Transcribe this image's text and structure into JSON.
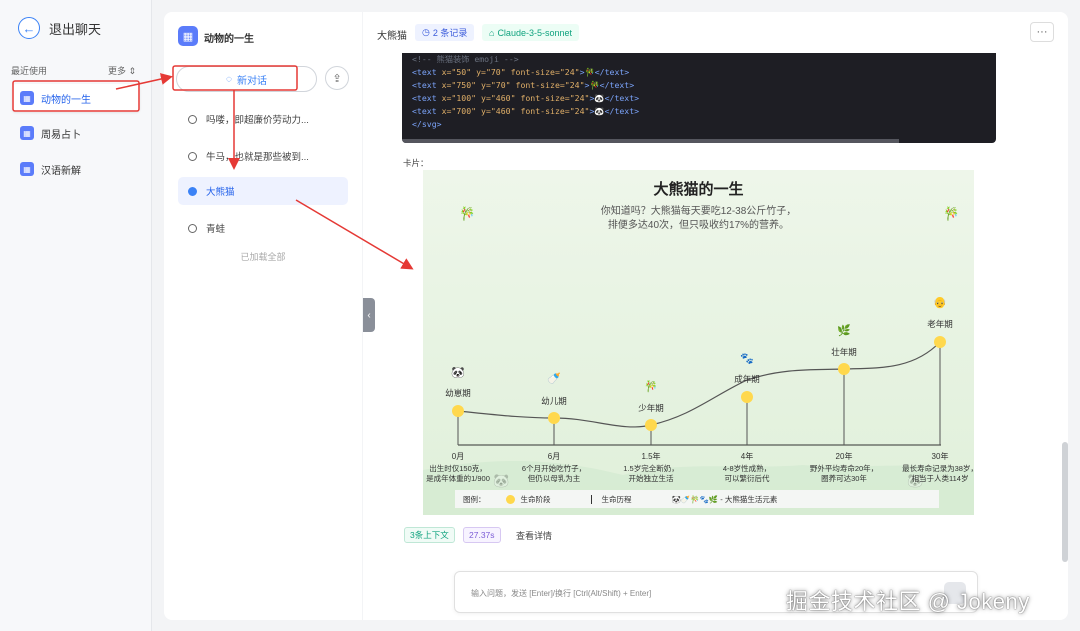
{
  "sidebar": {
    "exit_label": "退出聊天",
    "recent_label": "最近使用",
    "more_label": "更多 ⇕",
    "apps": [
      {
        "label": "动物的一生"
      },
      {
        "label": "周易占卜"
      },
      {
        "label": "汉语新解"
      }
    ]
  },
  "conversations": {
    "app_title": "动物的一生",
    "new_chat_label": "新对话",
    "items": [
      {
        "label": "吗喽，即超廉价劳动力..."
      },
      {
        "label": "牛马，也就是那些被到..."
      },
      {
        "label": "大熊猫"
      },
      {
        "label": "青蛙"
      }
    ],
    "loaded_all": "已加载全部"
  },
  "chat": {
    "name": "大熊猫",
    "records_tag": "2 条记录",
    "model_tag": "Claude-3-5-sonnet",
    "code_lines": [
      {
        "text": "<!-- 熊猫装饰 emoji -->",
        "kind": "comment"
      },
      {
        "pre": "<text ",
        "attr": "x=\"50\" y=\"70\" font-size=\"24\"",
        "post": ">🎋</text>"
      },
      {
        "pre": "<text ",
        "attr": "x=\"750\" y=\"70\" font-size=\"24\"",
        "post": ">🎋</text>"
      },
      {
        "pre": "<text ",
        "attr": "x=\"100\" y=\"460\" font-size=\"24\"",
        "post": ">🐼</text>"
      },
      {
        "pre": "<text ",
        "attr": "x=\"700\" y=\"460\" font-size=\"24\"",
        "post": ">🐼</text>"
      },
      {
        "text": "</svg>",
        "kind": "tag"
      }
    ],
    "card_label": "卡片：",
    "context_chip": "3条上下文",
    "time_chip": "27.37s",
    "detail_label": "查看详情",
    "input_placeholder": "输入问题，发送 [Enter]/换行 [Ctrl(Alt/Shift) + Enter]"
  },
  "card": {
    "title": "大熊猫的一生",
    "subtitle_1": "你知道吗？大熊猫每天要吃12-38公斤竹子，",
    "subtitle_2": "排便多达40次，但只吸收约17%的营养。",
    "stages": [
      {
        "x_label": "0月",
        "stage": "幼崽期",
        "emoji": "🐼",
        "desc": [
          "出生时仅150克，",
          "是成年体重的1/900"
        ]
      },
      {
        "x_label": "6月",
        "stage": "幼儿期",
        "emoji": "🍼",
        "desc": [
          "6个月开始吃竹子，",
          "但仍以母乳为主"
        ]
      },
      {
        "x_label": "1.5年",
        "stage": "少年期",
        "emoji": "🎋",
        "desc": [
          "1.5岁完全断奶，",
          "开始独立生活"
        ]
      },
      {
        "x_label": "4年",
        "stage": "成年期",
        "emoji": "🐾",
        "desc": [
          "4-8岁性成熟，",
          "可以繁衍后代"
        ]
      },
      {
        "x_label": "20年",
        "stage": "壮年期",
        "emoji": "🌿",
        "desc": [
          "野外平均寿命20年，",
          "圈养可达30年"
        ]
      },
      {
        "x_label": "30年",
        "stage": "老年期",
        "emoji": "👴",
        "desc": [
          "最长寿命记录为38岁，",
          "相当于人类114岁"
        ]
      }
    ],
    "deco_emoji": [
      "🎋",
      "🎋",
      "🐼",
      "🐼"
    ],
    "legend_label": "图例：",
    "legend_stage": "生命阶段",
    "legend_line": "生命历程",
    "legend_elements": "🐼🍼🎋🐾🌿 - 大熊猫生活元素"
  },
  "watermark": "掘金技术社区 @ Jokeny",
  "colors": {
    "annotation": "#e53935",
    "accent": "#3b82f6",
    "dot": "#ffd84d"
  }
}
